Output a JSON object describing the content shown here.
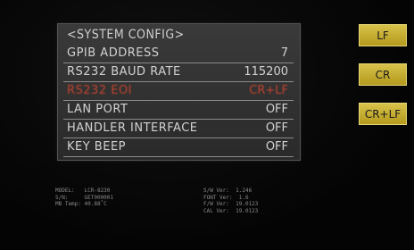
{
  "menu": {
    "title": "<SYSTEM CONFIG>",
    "rows": [
      {
        "label": "GPIB ADDRESS",
        "value": "7"
      },
      {
        "label": "RS232 BAUD RATE",
        "value": "115200"
      },
      {
        "label": "RS232 EOI",
        "value": "CR+LF",
        "selected": true
      },
      {
        "label": "LAN PORT",
        "value": "OFF"
      },
      {
        "label": "HANDLER INTERFACE",
        "value": "OFF"
      },
      {
        "label": "KEY BEEP",
        "value": "OFF"
      }
    ]
  },
  "softkeys": [
    "LF",
    "CR",
    "CR+LF"
  ],
  "info_left": {
    "model": "MODEL:   LCR-8230",
    "sn": "S/N:     GET000001",
    "mb_temp": "MB Temp: 40.88˚C"
  },
  "info_right": {
    "sw": "S/W Ver:  1.246",
    "font": "FONT Ver:  1.6",
    "fw": "F/W Ver:  19.0123",
    "cal": "CAL Ver:  19.0123"
  },
  "colors": {
    "softkey": "#d8c24a",
    "selected_row": "#c2442f",
    "menu_bg": "#333333"
  }
}
